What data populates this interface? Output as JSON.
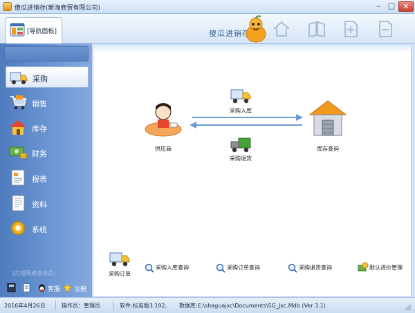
{
  "window": {
    "title": "傻瓜进销存(新海商贸有限公司)",
    "controls": {
      "minimize": "–",
      "maximize": "□",
      "close": "✕"
    }
  },
  "toolbar": {
    "nav_tab_label": "[导航面板]",
    "brand_text": "傻瓜进销存",
    "icons": [
      "home-icon",
      "book-icon",
      "add-page-icon",
      "remove-page-icon"
    ]
  },
  "sidebar": {
    "items": [
      {
        "label": "采购",
        "icon": "truck-icon",
        "active": true
      },
      {
        "label": "销售",
        "icon": "shopping-cart-icon",
        "active": false
      },
      {
        "label": "库存",
        "icon": "house-icon",
        "active": false
      },
      {
        "label": "财务",
        "icon": "money-icon",
        "active": false
      },
      {
        "label": "报表",
        "icon": "report-icon",
        "active": false
      },
      {
        "label": "资料",
        "icon": "document-icon",
        "active": false
      },
      {
        "label": "系统",
        "icon": "gear-icon",
        "active": false
      }
    ],
    "hint": "(灯塔网速查商品)",
    "bottom": {
      "support_label": "客服",
      "register_label": "注册"
    }
  },
  "flow": {
    "supplier_label": "供应商",
    "purchase_in_label": "采购入库",
    "purchase_return_label": "采购退货",
    "inventory_label": "库存查询",
    "actions": [
      {
        "label": "采购订单",
        "icon": "truck-icon"
      },
      {
        "label": "采购入库查询",
        "icon": "magnifier-icon"
      },
      {
        "label": "采购订单查询",
        "icon": "magnifier-icon"
      },
      {
        "label": "采购退货查询",
        "icon": "magnifier-icon"
      },
      {
        "label": "默认进价管理",
        "icon": "money-bag-icon"
      }
    ]
  },
  "status": {
    "date": "2016年4月26日",
    "operator": "操作员：管理员",
    "software": "软件:标准版3.192,",
    "database": "数据库:E:\\shaguajxc\\Documents\\SG_Jxc.Mdb (Ver 3.1)"
  },
  "colors": {
    "sidebar": "#5a87c8",
    "arrow": "#6b9ad6",
    "accent_orange": "#f39a1e"
  }
}
